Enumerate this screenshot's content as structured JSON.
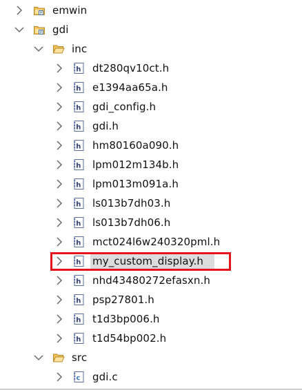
{
  "tree": {
    "items": [
      {
        "id": "emwin",
        "label": "emwin",
        "type": "folder-project",
        "expanded": false,
        "depth": 0
      },
      {
        "id": "gdi",
        "label": "gdi",
        "type": "folder-project",
        "expanded": true,
        "depth": 0
      },
      {
        "id": "inc",
        "label": "inc",
        "type": "folder-open",
        "expanded": true,
        "depth": 1
      },
      {
        "id": "f1",
        "label": "dt280qv10ct.h",
        "type": "header-file",
        "expanded": false,
        "depth": 2
      },
      {
        "id": "f2",
        "label": "e1394aa65a.h",
        "type": "header-file",
        "expanded": false,
        "depth": 2
      },
      {
        "id": "f3",
        "label": "gdi_config.h",
        "type": "header-file",
        "expanded": false,
        "depth": 2
      },
      {
        "id": "f4",
        "label": "gdi.h",
        "type": "header-file",
        "expanded": false,
        "depth": 2
      },
      {
        "id": "f5",
        "label": "hm80160a090.h",
        "type": "header-file",
        "expanded": false,
        "depth": 2
      },
      {
        "id": "f6",
        "label": "lpm012m134b.h",
        "type": "header-file",
        "expanded": false,
        "depth": 2
      },
      {
        "id": "f7",
        "label": "lpm013m091a.h",
        "type": "header-file",
        "expanded": false,
        "depth": 2
      },
      {
        "id": "f8",
        "label": "ls013b7dh03.h",
        "type": "header-file",
        "expanded": false,
        "depth": 2
      },
      {
        "id": "f9",
        "label": "ls013b7dh06.h",
        "type": "header-file",
        "expanded": false,
        "depth": 2
      },
      {
        "id": "f10",
        "label": "mct024l6w240320pml.h",
        "type": "header-file",
        "expanded": false,
        "depth": 2
      },
      {
        "id": "f11",
        "label": "my_custom_display.h",
        "type": "header-file",
        "expanded": false,
        "depth": 2,
        "selected": true
      },
      {
        "id": "f12",
        "label": "nhd43480272efasxn.h",
        "type": "header-file",
        "expanded": false,
        "depth": 2
      },
      {
        "id": "f13",
        "label": "psp27801.h",
        "type": "header-file",
        "expanded": false,
        "depth": 2
      },
      {
        "id": "f14",
        "label": "t1d3bp006.h",
        "type": "header-file",
        "expanded": false,
        "depth": 2
      },
      {
        "id": "f15",
        "label": "t1d54bp002.h",
        "type": "header-file",
        "expanded": false,
        "depth": 2
      },
      {
        "id": "src",
        "label": "src",
        "type": "folder-open",
        "expanded": true,
        "depth": 1
      },
      {
        "id": "c1",
        "label": "gdi.c",
        "type": "c-file",
        "expanded": false,
        "depth": 2
      }
    ]
  },
  "colors": {
    "highlight": "#e3141b",
    "selection": "#dcdcdc",
    "folder": "#f2c15a",
    "header_icon": "#5a6f9e",
    "c_icon": "#3c74c4"
  }
}
